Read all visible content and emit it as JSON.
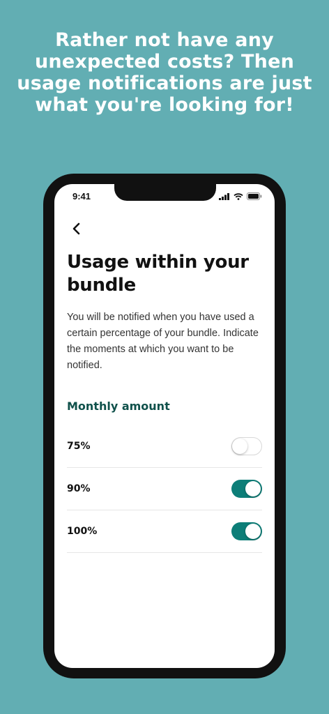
{
  "promo": {
    "headline": "Rather not have any unexpected costs? Then usage notifications are just what you're looking for!"
  },
  "status_bar": {
    "time": "9:41",
    "icons": [
      "signal-icon",
      "wifi-icon",
      "battery-icon"
    ]
  },
  "screen": {
    "back_icon": "chevron-left-icon",
    "title": "Usage within your bundle",
    "description": "You will be notified when you have used a certain percentage of your bundle. Indicate the moments at which you want to be notified.",
    "section_title": "Monthly amount",
    "options": [
      {
        "label": "75%",
        "enabled": false
      },
      {
        "label": "90%",
        "enabled": true
      },
      {
        "label": "100%",
        "enabled": true
      }
    ]
  },
  "colors": {
    "background": "#62aeb3",
    "accent": "#0d7e78",
    "section_title": "#10514b"
  }
}
